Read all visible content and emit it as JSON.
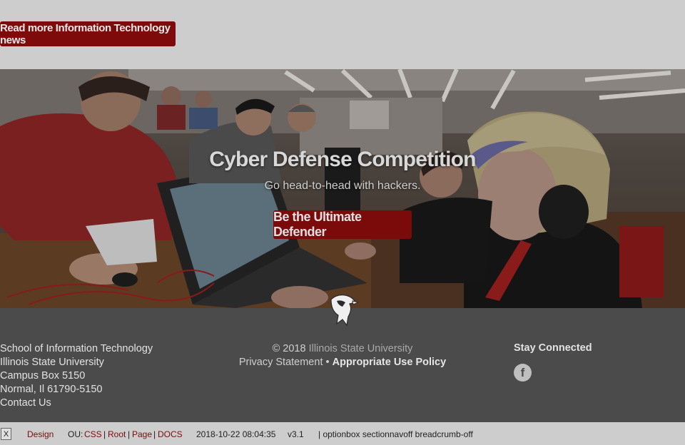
{
  "news_button": {
    "label": "Read more Information Technology news"
  },
  "hero": {
    "title": "Cyber Defense Competition",
    "subtitle": "Go head-to-head with hackers.",
    "cta_label": "Be the Ultimate Defender",
    "image_description": ""
  },
  "footer": {
    "address": {
      "line1": "School of Information Technology",
      "line2": "Illinois State University",
      "line3": "Campus Box 5150",
      "line4": "Normal, Il 61790-5150",
      "contact": "Contact Us"
    },
    "copyright_prefix": "© 2018",
    "university_link": "Illinois State University",
    "privacy": "Privacy Statement",
    "separator": "•",
    "aup": "Appropriate Use Policy",
    "stay_connected": "Stay Connected",
    "facebook_glyph": "f"
  },
  "statusbar": {
    "close": "X",
    "design": "Design",
    "ou_label": "OU:",
    "css": "CSS",
    "root": "Root",
    "page": "Page",
    "docs": "DOCS",
    "pipe": "|",
    "timestamp": "2018-10-22 08:04:35",
    "version": "v3.1",
    "options": "| optionbox sectionnavoff breadcrumb-off"
  }
}
